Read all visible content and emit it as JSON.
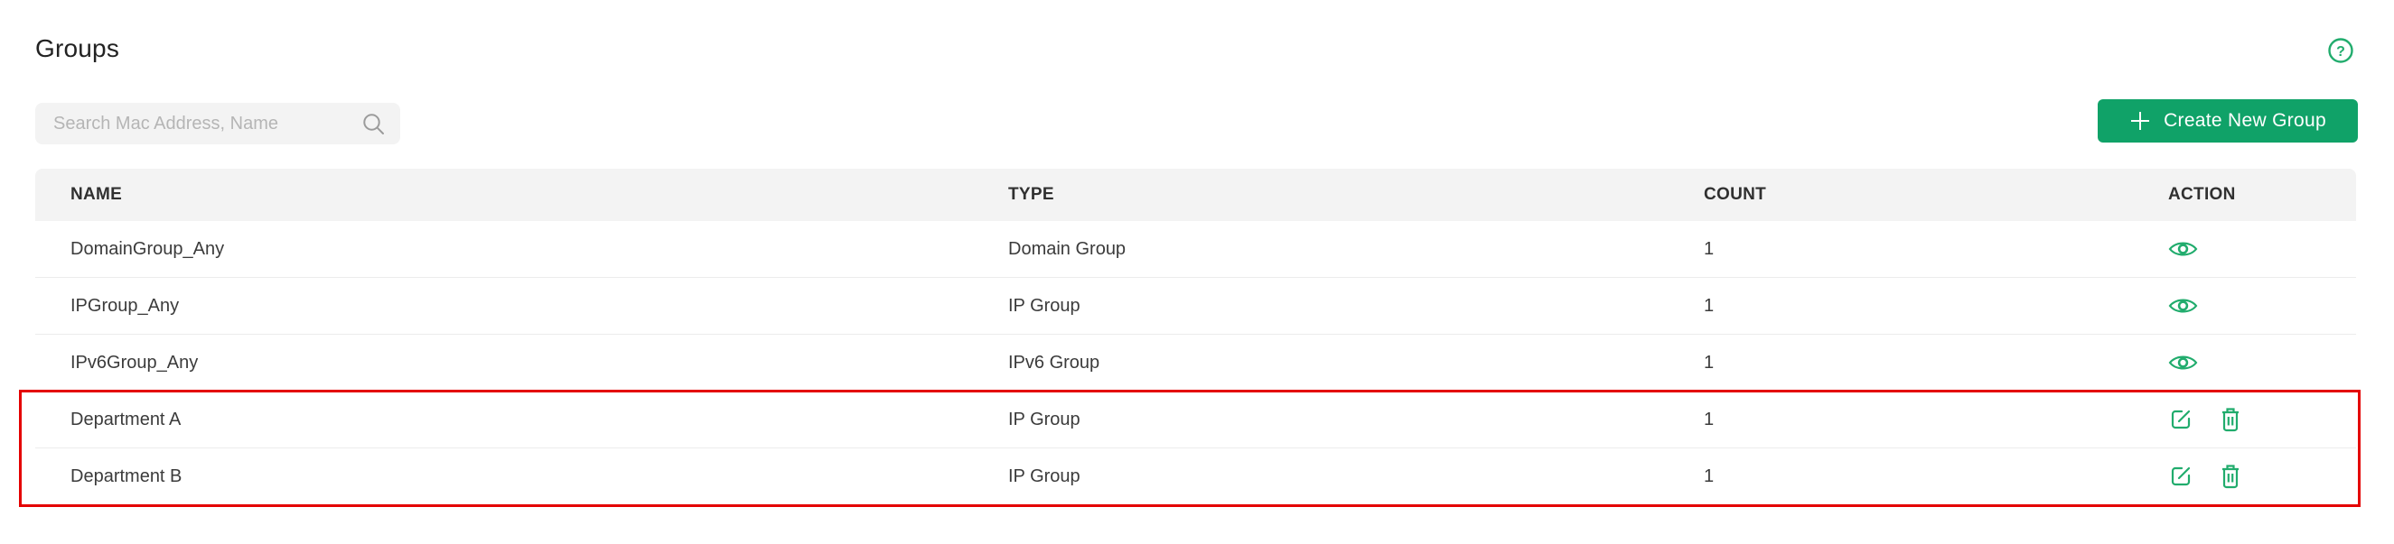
{
  "page": {
    "title": "Groups"
  },
  "search": {
    "placeholder": "Search Mac Address, Name"
  },
  "create_button": {
    "label": "Create New Group"
  },
  "help": {
    "symbol": "?"
  },
  "table": {
    "columns": [
      "NAME",
      "TYPE",
      "COUNT",
      "ACTION"
    ],
    "rows": [
      {
        "name": "DomainGroup_Any",
        "type": "Domain Group",
        "count": "1",
        "actions": [
          "view"
        ],
        "highlighted": false
      },
      {
        "name": "IPGroup_Any",
        "type": "IP Group",
        "count": "1",
        "actions": [
          "view"
        ],
        "highlighted": false
      },
      {
        "name": "IPv6Group_Any",
        "type": "IPv6 Group",
        "count": "1",
        "actions": [
          "view"
        ],
        "highlighted": false
      },
      {
        "name": "Department A",
        "type": "IP Group",
        "count": "1",
        "actions": [
          "edit",
          "delete"
        ],
        "highlighted": true
      },
      {
        "name": "Department B",
        "type": "IP Group",
        "count": "1",
        "actions": [
          "edit",
          "delete"
        ],
        "highlighted": true
      }
    ]
  },
  "colors": {
    "brand_green": "#10a268",
    "icon_green": "#21ac6d",
    "highlight_red": "#e40000",
    "panel_gray": "#f3f3f3"
  }
}
